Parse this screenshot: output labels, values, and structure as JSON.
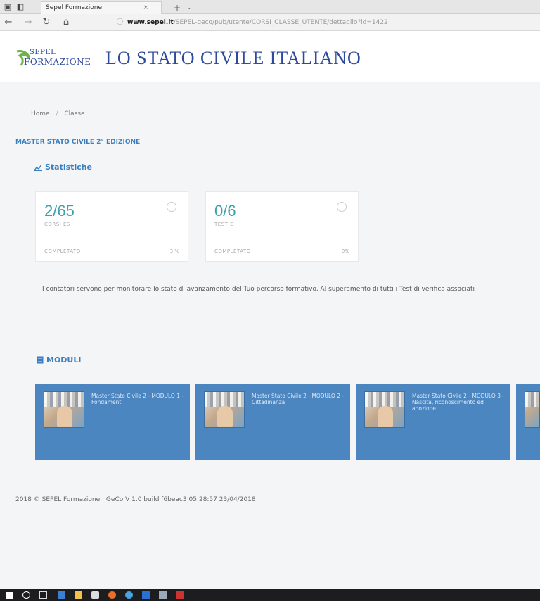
{
  "browser": {
    "tab_title": "Sepel Formazione",
    "tab_close": "×",
    "tab_new": "+",
    "tab_more": "⌄",
    "url_host": "www.sepel.it",
    "url_path": "/SEPEL-geco/pub/utente/CORSI_CLASSE_UTENTE/dettaglio?id=1422"
  },
  "header": {
    "logo_top": "SEPEL",
    "logo_bottom": "FORMAZIONE",
    "title": "LO STATO CIVILE ITALIANO"
  },
  "breadcrumb": {
    "home": "Home",
    "separator": "/",
    "current": "Classe"
  },
  "course_title": "MASTER STATO CIVILE 2° EDIZIONE",
  "stats": {
    "heading": "Statistiche",
    "cards": [
      {
        "value": "2/65",
        "label": "CORSI ES",
        "foot_label": "COMPLETATO",
        "foot_value": "3 %"
      },
      {
        "value": "0/6",
        "label": "TEST E",
        "foot_label": "COMPLETATO",
        "foot_value": "0%"
      }
    ]
  },
  "info_text": "I contatori servono per monitorare lo stato di avanzamento del Tuo percorso formativo. Al superamento di tutti i Test di verifica associati",
  "modules": {
    "heading": "MODULI",
    "items": [
      {
        "title": "Master Stato Civile 2 - MODULO 1 - Fondamenti"
      },
      {
        "title": "Master Stato Civile 2 - MODULO 2 - Cittadinanza"
      },
      {
        "title": "Master Stato Civile 2 - MODULO 3 - Nascita, riconoscimento ed adozione"
      }
    ]
  },
  "footer": "2018 © SEPEL Formazione | GeCo V 1.0 build f6beac3 05:28:57 23/04/2018",
  "colors": {
    "accent": "#3a7fc0",
    "stat_value": "#3aa3a9",
    "module_bg": "#4c86c0",
    "taskbar": "#1d1d1f"
  }
}
